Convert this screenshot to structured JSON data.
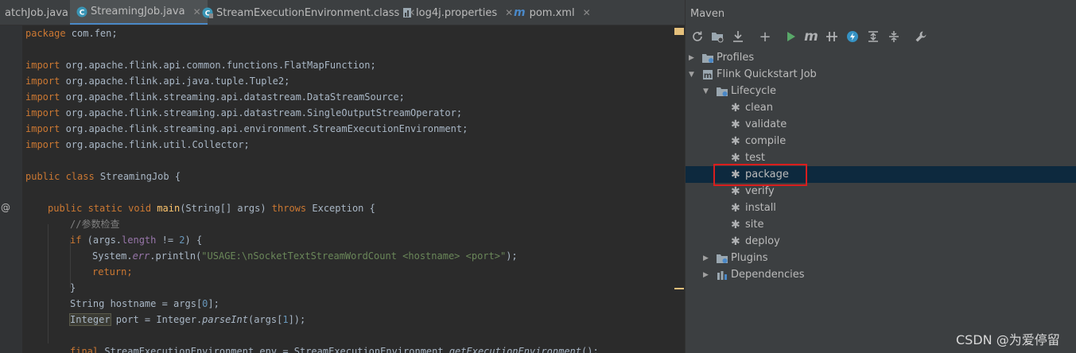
{
  "editor": {
    "tabs": [
      {
        "label": "atchJob.java",
        "icon": "java-class-icon"
      },
      {
        "label": "StreamingJob.java",
        "icon": "java-class-icon",
        "active": true
      },
      {
        "label": "StreamExecutionEnvironment.class",
        "icon": "class-file-icon"
      },
      {
        "label": "log4j.properties",
        "icon": "properties-file-icon"
      },
      {
        "label": "pom.xml",
        "icon": "maven-icon"
      }
    ],
    "close_glyph": "✕",
    "gutter_marker": "@",
    "code": {
      "l1": {
        "a": "package",
        "b": " com.fen;"
      },
      "l3": {
        "a": "import",
        "b": " org.apache.flink.api.common.functions.FlatMapFunction;"
      },
      "l4": {
        "a": "import",
        "b": " org.apache.flink.api.java.tuple.Tuple2;"
      },
      "l5": {
        "a": "import",
        "b": " org.apache.flink.streaming.api.datastream.DataStreamSource;"
      },
      "l6": {
        "a": "import",
        "b": " org.apache.flink.streaming.api.datastream.SingleOutputStreamOperator;"
      },
      "l7": {
        "a": "import",
        "b": " org.apache.flink.streaming.api.environment.StreamExecutionEnvironment;"
      },
      "l8": {
        "a": "import",
        "b": " org.apache.flink.util.Collector;"
      },
      "l10": {
        "a": "public class",
        "b": " StreamingJob {"
      },
      "l12": {
        "a": "public static void",
        "b": " ",
        "c": "main",
        "d": "(String[] args) ",
        "e": "throws",
        "f": " Exception {"
      },
      "l13": {
        "a": "//参数检查"
      },
      "l14": {
        "a": "if",
        "b": " (args.",
        "c": "length",
        "d": " != ",
        "e": "2",
        "f": ") {"
      },
      "l15": {
        "a": "System.",
        "b": "err",
        "c": ".println(",
        "d": "\"USAGE:\\nSocketTextStreamWordCount <hostname> <port>\"",
        "e": ");"
      },
      "l16": {
        "a": "return",
        "b": ";"
      },
      "l17": {
        "a": "}"
      },
      "l18": {
        "a": "String hostname = args[",
        "b": "0",
        "c": "];"
      },
      "l19": {
        "a": "Integer",
        "b": " port = Integer.",
        "c": "parseInt",
        "d": "(args[",
        "e": "1",
        "f": "]);"
      },
      "l21": {
        "a": "final",
        "b": " StreamExecutionEnvironment env = StreamExecutionEnvironment.",
        "c": "getExecutionEnvironment",
        "d": "();"
      }
    }
  },
  "maven": {
    "title": "Maven",
    "toolbar": [
      {
        "name": "reload-icon",
        "glyph": "⟳"
      },
      {
        "name": "add-folder-icon"
      },
      {
        "name": "download-icon"
      },
      {
        "name": "add-icon",
        "glyph": "+"
      },
      {
        "name": "run-icon"
      },
      {
        "name": "maven-goal-icon",
        "glyph": "m"
      },
      {
        "name": "toggle-offline-icon"
      },
      {
        "name": "skip-tests-icon"
      },
      {
        "name": "show-dependencies-icon"
      },
      {
        "name": "collapse-all-icon"
      },
      {
        "name": "settings-wrench-icon"
      }
    ],
    "tree": {
      "profiles": "Profiles",
      "project": "Flink Quickstart Job",
      "lifecycle": "Lifecycle",
      "phases": [
        "clean",
        "validate",
        "compile",
        "test",
        "package",
        "verify",
        "install",
        "site",
        "deploy"
      ],
      "selected_phase": "package",
      "plugins": "Plugins",
      "dependencies": "Dependencies"
    }
  },
  "watermark": "CSDN @为爱停留",
  "colors": {
    "keyword": "#cc7832",
    "string": "#6a8759",
    "method": "#ffc66d",
    "field": "#9876aa",
    "selection": "#0d293e",
    "highlight_box": "#d81e1e"
  }
}
